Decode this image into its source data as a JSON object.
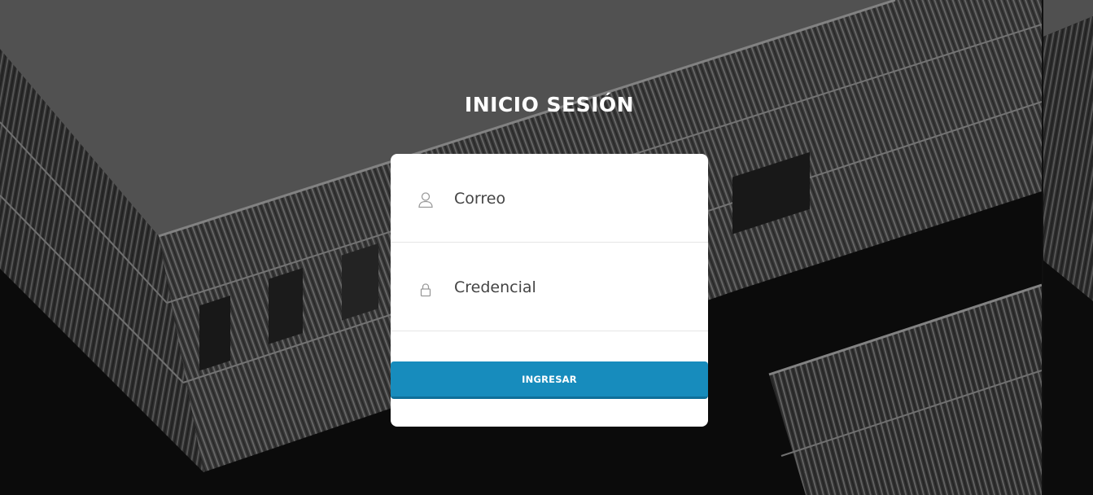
{
  "page": {
    "title": "INICIO SESIÓN"
  },
  "form": {
    "email": {
      "placeholder": "Correo",
      "value": "",
      "icon": "user-icon"
    },
    "password": {
      "placeholder": "Credencial",
      "value": "",
      "icon": "lock-icon"
    },
    "submit_label": "INGRESAR"
  },
  "colors": {
    "button": "#178cbd",
    "button_shadow": "#0f6f99",
    "card": "#ffffff",
    "title": "#ffffff"
  }
}
